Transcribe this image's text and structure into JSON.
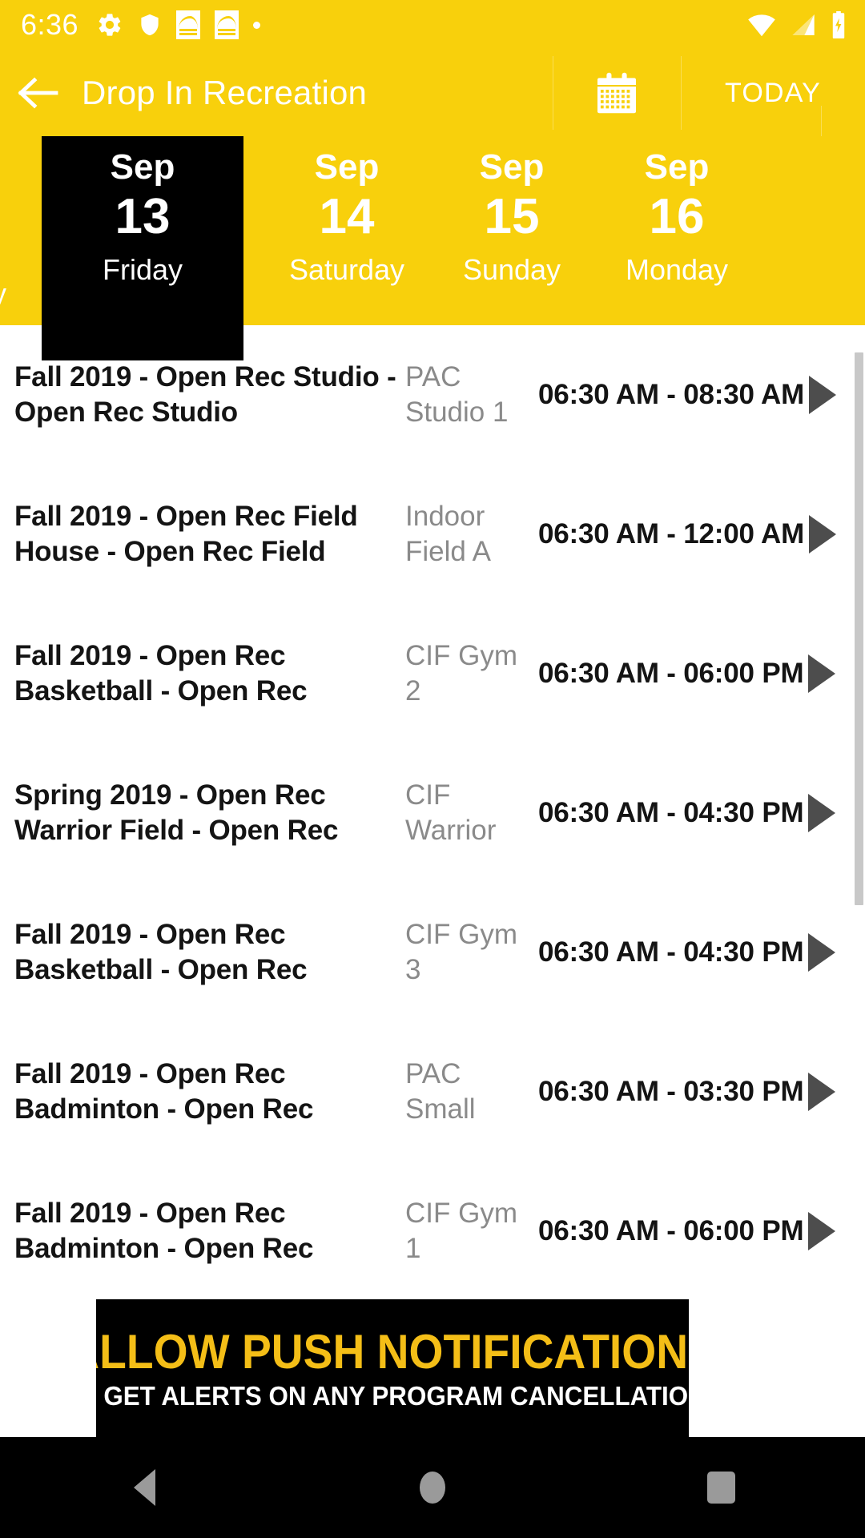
{
  "status_bar": {
    "clock": "6:36",
    "left_icons": [
      "gear-icon",
      "shield-icon",
      "app-notification-icon",
      "app-notification-icon",
      "dot-icon"
    ],
    "right_icons": [
      "wifi-icon",
      "cellular-signal-icon",
      "battery-charging-icon"
    ]
  },
  "app_bar": {
    "back_icon": "arrow-left-icon",
    "title": "Drop In Recreation",
    "calendar_icon": "calendar-icon",
    "today_label": "TODAY"
  },
  "date_strip": {
    "partial_prev_label": "y",
    "tabs": [
      {
        "month": "Sep",
        "day": "13",
        "weekday": "Friday",
        "selected": true
      },
      {
        "month": "Sep",
        "day": "14",
        "weekday": "Saturday",
        "selected": false
      },
      {
        "month": "Sep",
        "day": "15",
        "weekday": "Sunday",
        "selected": false
      },
      {
        "month": "Sep",
        "day": "16",
        "weekday": "Monday",
        "selected": false
      }
    ]
  },
  "list": {
    "rows": [
      {
        "title": "Fall 2019 - Open Rec Studio - Open Rec Studio",
        "location": "PAC Studio 1",
        "time": "06:30 AM - 08:30 AM",
        "arrow": "chevron-right-icon"
      },
      {
        "title": "Fall 2019 - Open Rec Field House - Open Rec Field",
        "location": "Indoor Field A",
        "time": "06:30 AM - 12:00 AM",
        "arrow": "chevron-right-icon"
      },
      {
        "title": "Fall 2019 - Open Rec Basketball - Open Rec",
        "location": "CIF Gym 2",
        "time": "06:30 AM - 06:00 PM",
        "arrow": "chevron-right-icon"
      },
      {
        "title": "Spring 2019 - Open Rec Warrior Field - Open Rec",
        "location": "CIF Warrior",
        "time": "06:30 AM - 04:30 PM",
        "arrow": "chevron-right-icon"
      },
      {
        "title": "Fall 2019 - Open Rec Basketball - Open Rec",
        "location": "CIF Gym 3",
        "time": "06:30 AM - 04:30 PM",
        "arrow": "chevron-right-icon"
      },
      {
        "title": "Fall 2019 - Open Rec Badminton - Open Rec",
        "location": "PAC Small",
        "time": "06:30 AM - 03:30 PM",
        "arrow": "chevron-right-icon"
      },
      {
        "title": "Fall 2019 - Open Rec Badminton - Open Rec",
        "location": "CIF Gym 1",
        "time": "06:30 AM - 06:00 PM",
        "arrow": "chevron-right-icon"
      }
    ]
  },
  "banner": {
    "line1": "ALLOW PUSH NOTIFICATIONS",
    "line2": "TO GET ALERTS ON ANY PROGRAM CANCELLATIONS"
  },
  "nav_bar": {
    "back": "nav-back-icon",
    "home": "nav-home-icon",
    "recents": "nav-recents-icon"
  },
  "colors": {
    "brand_yellow": "#F8D00C",
    "selected_tab_bg": "#000000",
    "banner_accent": "#F4BE17",
    "arrow_gray": "#4D4D4D",
    "location_gray": "#8A8A8A"
  }
}
